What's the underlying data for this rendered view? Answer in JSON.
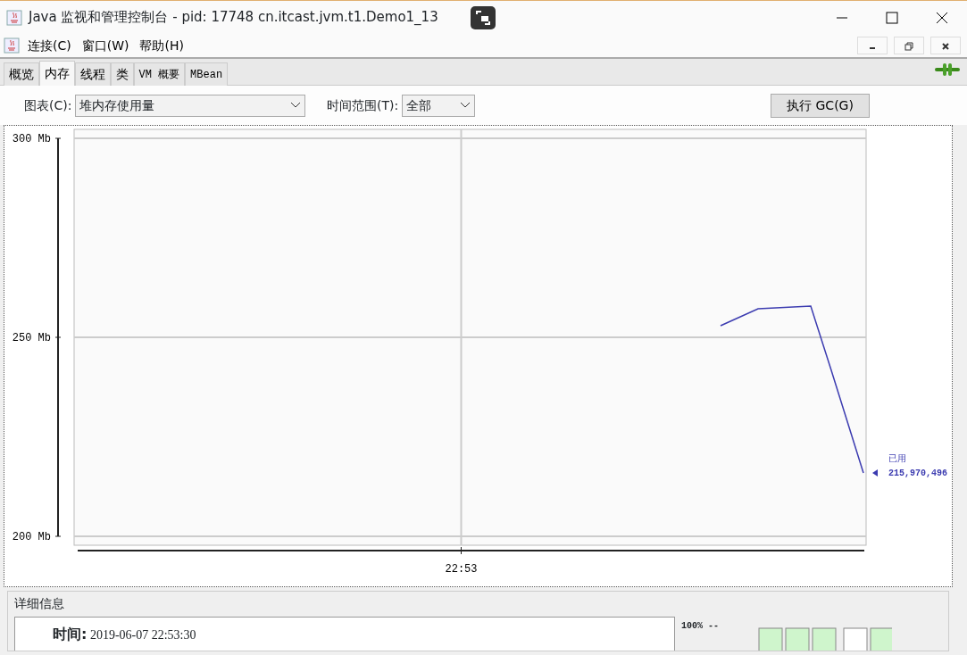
{
  "window": {
    "title": "Java 监视和管理控制台 - pid: 17748 cn.itcast.jvm.t1.Demo1_13"
  },
  "menu": [
    "连接(C)",
    "窗口(W)",
    "帮助(H)"
  ],
  "tabs": [
    {
      "label": "概览",
      "selected": false
    },
    {
      "label": "内存",
      "selected": true
    },
    {
      "label": "线程",
      "selected": false
    },
    {
      "label": "类",
      "selected": false
    },
    {
      "label": "VM 概要",
      "selected": false
    },
    {
      "label": "MBean",
      "selected": false
    }
  ],
  "chart_selector": {
    "label": "图表(C):",
    "value": "堆内存使用量"
  },
  "time_range": {
    "label": "时间范围(T):",
    "value": "全部"
  },
  "gc_button": "执行 GC(G)",
  "chart": {
    "y_labels": [
      "300 Mb",
      "250 Mb",
      "200 Mb"
    ],
    "x_label": "22:53",
    "legend_label": "已用",
    "legend_value": "215,970,496"
  },
  "details": {
    "title": "详细信息",
    "time_label": "时间:",
    "time_value": "2019-06-07 22:53:30",
    "bar_scale": "100% --"
  }
}
